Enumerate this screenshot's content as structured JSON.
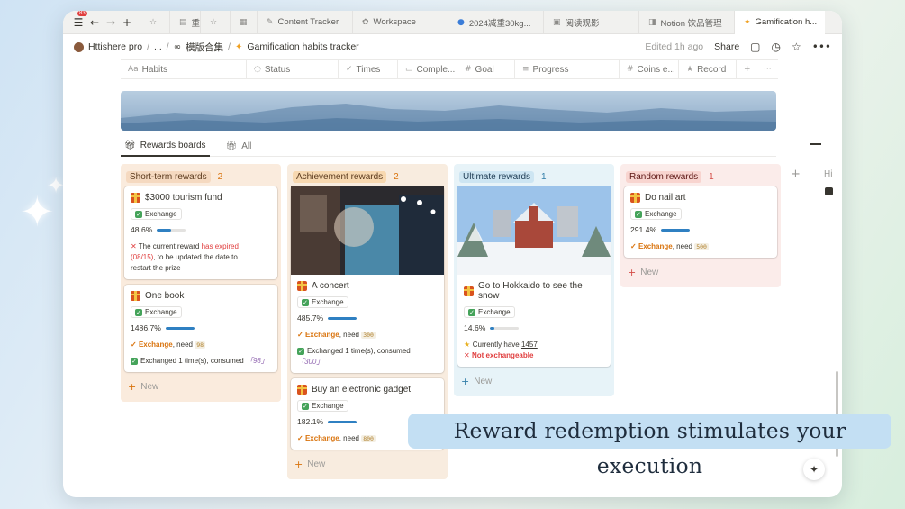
{
  "tabbar": {
    "notif_badge": "83",
    "tabs": [
      {
        "label": "",
        "icon": "star-icon"
      },
      {
        "label": "重...",
        "icon": "page-icon"
      },
      {
        "label": "",
        "icon": "star-icon"
      },
      {
        "label": "",
        "icon": "calendar-icon"
      },
      {
        "label": "Content Tracker",
        "icon": "pen-icon"
      },
      {
        "label": "Workspace",
        "icon": "workspace-icon"
      },
      {
        "label": "2024减重30kg...",
        "icon": "circle-icon"
      },
      {
        "label": "阅读观影",
        "icon": "table-icon"
      },
      {
        "label": "Notion 饮品管理",
        "icon": "notion-icon"
      },
      {
        "label": "Gamification h...",
        "icon": "sparkle-icon"
      }
    ]
  },
  "breadcrumb": {
    "workspace": "Httishere pro",
    "ellipsis": "...",
    "parent": "模版合集",
    "current": "Gamification habits tracker"
  },
  "header": {
    "edited": "Edited 1h ago",
    "share": "Share"
  },
  "properties": [
    {
      "label": "Habits",
      "icon": "Aa"
    },
    {
      "label": "Status",
      "icon": "◌"
    },
    {
      "label": "Times",
      "icon": "✓"
    },
    {
      "label": "Comple...",
      "icon": "▭"
    },
    {
      "label": "Goal",
      "icon": "#"
    },
    {
      "label": "Progress",
      "icon": "≡"
    },
    {
      "label": "Coins e...",
      "icon": "#"
    },
    {
      "label": "Record",
      "icon": "★"
    }
  ],
  "views": {
    "active": "Rewards boards",
    "all": "All"
  },
  "columns": [
    {
      "title": "Short-term rewards",
      "count": "2"
    },
    {
      "title": "Achievement rewards",
      "count": "2"
    },
    {
      "title": "Ultimate rewards",
      "count": "1"
    },
    {
      "title": "Random rewards",
      "count": "1"
    }
  ],
  "cards": {
    "tourism": {
      "title": "$3000 tourism fund",
      "tag": "Exchange",
      "percent": "48.6%",
      "progress": 0.486,
      "l1a": "The current reward ",
      "l1b": "has expired",
      "l2a": "(08/15)",
      "l2b": ", to be updated the date to",
      "l3": "restart the prize"
    },
    "book": {
      "title": "One book",
      "tag": "Exchange",
      "percent": "1486.7%",
      "progress": 1.0,
      "status": "Exchange",
      "need_label": ", need ",
      "need": "98",
      "exchanged_a": "Exchanged 1 time(s), consumed ",
      "exchanged_b": "「98」"
    },
    "concert": {
      "title": "A concert",
      "tag": "Exchange",
      "percent": "485.7%",
      "progress": 1.0,
      "status": "Exchange",
      "need_label": ", need ",
      "need": "300",
      "exchanged_a": "Exchanged 1 time(s), consumed",
      "exchanged_b": "「300」"
    },
    "gadget": {
      "title": "Buy an electronic gadget",
      "tag": "Exchange",
      "percent": "182.1%",
      "progress": 1.0,
      "status": "Exchange",
      "need_label": ", need ",
      "need": "800"
    },
    "hokkaido": {
      "title": "Go to Hokkaido to see the snow",
      "tag": "Exchange",
      "percent": "14.6%",
      "progress": 0.146,
      "have_label": "Currently have ",
      "have": "1457",
      "not_ex": "Not exchangeable"
    },
    "nail": {
      "title": "Do nail art",
      "tag": "Exchange",
      "percent": "291.4%",
      "progress": 1.0,
      "status": "Exchange",
      "need_label": ", need ",
      "need": "500"
    }
  },
  "new_label": "New",
  "side": {
    "hi": "Hi"
  },
  "caption": "Reward redemption stimulates your execution",
  "colors": {
    "short_bg": "#faebdd",
    "achieve_bg": "#f8ecdf",
    "ultimate_bg": "#e7f3f8",
    "random_bg": "#fbecea",
    "progress_fill": "#2f80c2",
    "exchange_orange": "#d9730d",
    "expired_red": "#e03e3e"
  }
}
